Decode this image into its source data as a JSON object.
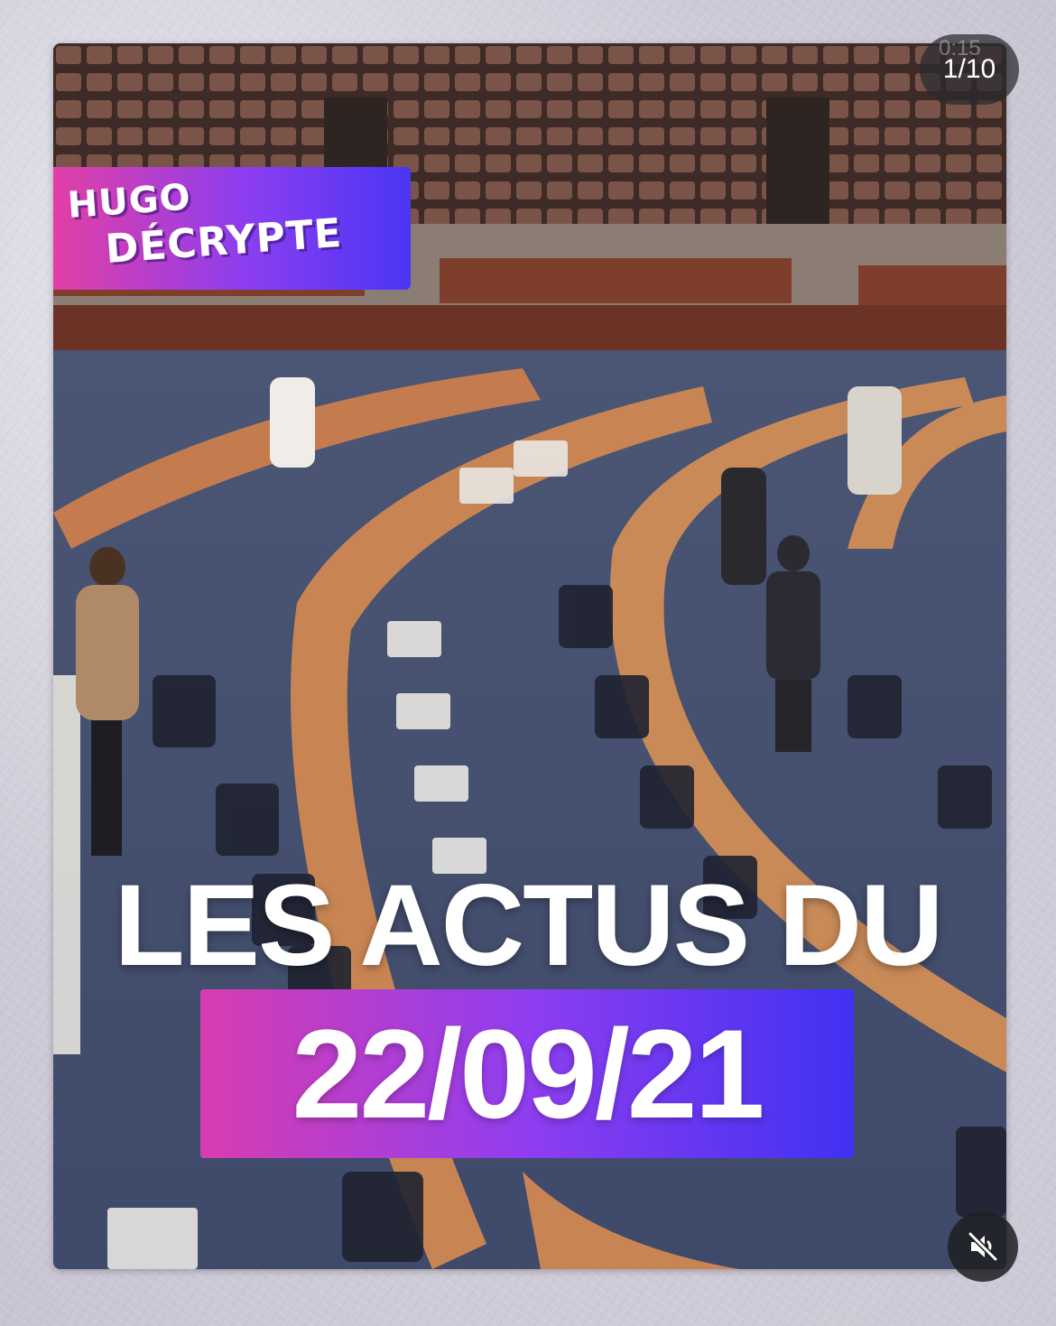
{
  "story": {
    "progress_label": "1/10",
    "timestamp_label": "0:15",
    "logo": {
      "line1": "HUGO",
      "line2": "DÉCRYPTE"
    },
    "headline": "LES ACTUS DU",
    "date": "22/09/21",
    "mute_icon": "speaker-muted-icon"
  },
  "colors": {
    "gradient_start": "#e23fa5",
    "gradient_end": "#4b35f5",
    "text": "#ffffff"
  }
}
